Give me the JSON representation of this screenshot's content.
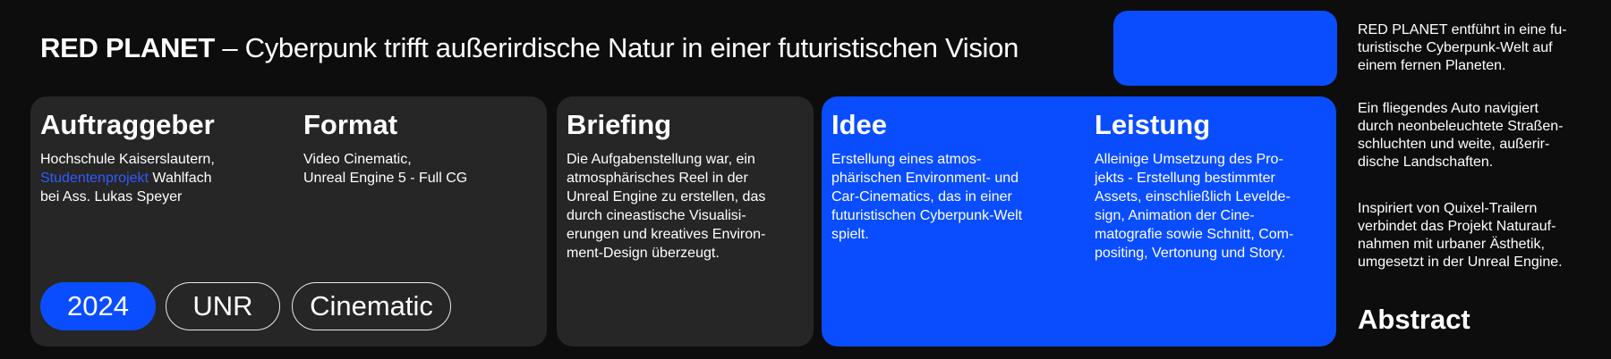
{
  "header": {
    "title_bold": "RED PLANET",
    "title_rest": " – Cyberpunk trifft außerirdische Natur in einer futuristischen Vision"
  },
  "client": {
    "heading": "Auftraggeber",
    "line1": "Hochschule Kaiserslautern,",
    "link": "Studentenprojekt",
    "line2_rest": " Wahlfach",
    "line3": "bei Ass. Lukas Speyer"
  },
  "format": {
    "heading": "Format",
    "lines": [
      "Video Cinematic,",
      "Unreal Engine 5 - Full CG"
    ]
  },
  "tags": [
    "2024",
    "UNR",
    "Cinematic"
  ],
  "briefing": {
    "heading": "Briefing",
    "lines": [
      "Die Aufgabenstellung war, ein",
      "atmosphärisches Reel in der",
      "Unreal Engine zu erstellen, das",
      "durch cineastische Visualisi-",
      "erungen und kreatives Environ-",
      "ment-Design überzeugt."
    ]
  },
  "idea": {
    "heading": "Idee",
    "lines": [
      "Erstellung eines atmos-",
      "phärischen Environment- und",
      "Car-Cinematics, das in einer",
      "futuristischen Cyberpunk-Welt",
      "spielt."
    ]
  },
  "service": {
    "heading": "Leistung",
    "lines": [
      "Alleinige Umsetzung des Pro-",
      "jekts - Erstellung bestimmter",
      "Assets, einschließlich Levelde-",
      "sign, Animation der Cine-",
      "matografie sowie Schnitt, Com-",
      "positing, Vertonung und Story."
    ]
  },
  "abstract": {
    "para1": [
      "RED PLANET entführt in eine fu-",
      "turistische Cyberpunk-Welt auf",
      "einem fernen Planeten."
    ],
    "para2": [
      "Ein fliegendes Auto navigiert",
      "durch neonbeleuchtete Straßen-",
      "schluchten und weite, außerir-",
      "dische Landschaften."
    ],
    "para3": [
      "Inspiriert von Quixel-Trailern",
      "verbindet das Projekt Naturauf-",
      "nahmen mit urbaner Ästhetik,",
      "umgesetzt in der Unreal Engine."
    ],
    "heading": "Abstract"
  },
  "colors": {
    "accent": "#0a4dff",
    "panel": "#262626",
    "background": "#0d0d0d",
    "link": "#2f5bff"
  }
}
